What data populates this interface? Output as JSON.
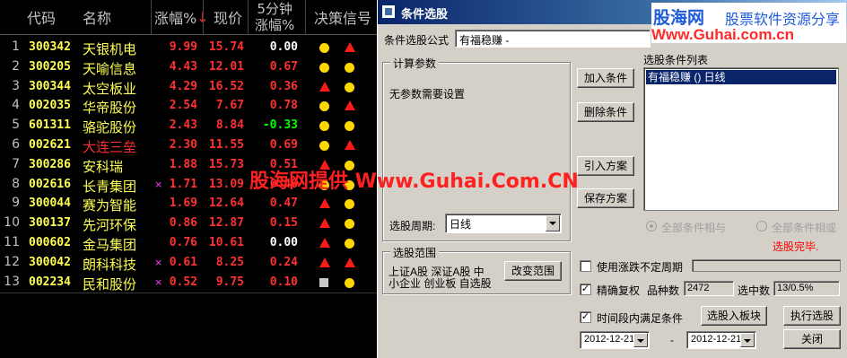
{
  "table": {
    "headers": {
      "code": "代码",
      "name": "名称",
      "pct": "涨幅%",
      "pct_arrow": "↓",
      "price": "现价",
      "five_min_top": "5分钟",
      "five_min_bottom": "涨幅%",
      "signal": "决策信号"
    },
    "rows": [
      {
        "idx": "1",
        "code": "300342",
        "name": "天银机电",
        "name_color": "yellow",
        "mark": "",
        "pct": "9.99",
        "price": "15.74",
        "m5": "0.00",
        "m5_color": "#ffffff",
        "s1": "dot",
        "s2": "tri"
      },
      {
        "idx": "2",
        "code": "300205",
        "name": "天喻信息",
        "name_color": "yellow",
        "mark": "",
        "pct": "4.43",
        "price": "12.01",
        "m5": "0.67",
        "m5_color": "#ff3030",
        "s1": "dot",
        "s2": "dot"
      },
      {
        "idx": "3",
        "code": "300344",
        "name": "太空板业",
        "name_color": "yellow",
        "mark": "",
        "pct": "4.29",
        "price": "16.52",
        "m5": "0.36",
        "m5_color": "#ff3030",
        "s1": "tri",
        "s2": "dot"
      },
      {
        "idx": "4",
        "code": "002035",
        "name": "华帝股份",
        "name_color": "yellow",
        "mark": "",
        "pct": "2.54",
        "price": "7.67",
        "m5": "0.78",
        "m5_color": "#ff3030",
        "s1": "dot",
        "s2": "tri"
      },
      {
        "idx": "5",
        "code": "601311",
        "name": "骆驼股份",
        "name_color": "yellow",
        "mark": "",
        "pct": "2.43",
        "price": "8.84",
        "m5": "-0.33",
        "m5_color": "#00ff00",
        "s1": "dot",
        "s2": "dot"
      },
      {
        "idx": "6",
        "code": "002621",
        "name": "大连三垒",
        "name_color": "red",
        "mark": "",
        "pct": "2.30",
        "price": "11.55",
        "m5": "0.69",
        "m5_color": "#ff3030",
        "s1": "dot",
        "s2": "tri"
      },
      {
        "idx": "7",
        "code": "300286",
        "name": "安科瑞",
        "name_color": "yellow",
        "mark": "",
        "pct": "1.88",
        "price": "15.73",
        "m5": "0.51",
        "m5_color": "#ff3030",
        "s1": "tri",
        "s2": "dot"
      },
      {
        "idx": "8",
        "code": "002616",
        "name": "长青集团",
        "name_color": "yellow",
        "mark": "×",
        "pct": "1.71",
        "price": "13.09",
        "m5": "0.46",
        "m5_color": "#ff3030",
        "s1": "dot",
        "s2": "dot"
      },
      {
        "idx": "9",
        "code": "300044",
        "name": "赛为智能",
        "name_color": "yellow",
        "mark": "",
        "pct": "1.69",
        "price": "12.64",
        "m5": "0.47",
        "m5_color": "#ff3030",
        "s1": "tri",
        "s2": "dot"
      },
      {
        "idx": "10",
        "code": "300137",
        "name": "先河环保",
        "name_color": "yellow",
        "mark": "",
        "pct": "0.86",
        "price": "12.87",
        "m5": "0.15",
        "m5_color": "#ff3030",
        "s1": "tri",
        "s2": "dot"
      },
      {
        "idx": "11",
        "code": "000602",
        "name": "金马集团",
        "name_color": "yellow",
        "mark": "",
        "pct": "0.76",
        "price": "10.61",
        "m5": "0.00",
        "m5_color": "#ffffff",
        "s1": "tri",
        "s2": "dot"
      },
      {
        "idx": "12",
        "code": "300042",
        "name": "朗科科技",
        "name_color": "yellow",
        "mark": "×",
        "pct": "0.61",
        "price": "8.25",
        "m5": "0.24",
        "m5_color": "#ff3030",
        "s1": "tri",
        "s2": "tri"
      },
      {
        "idx": "13",
        "code": "002234",
        "name": "民和股份",
        "name_color": "yellow",
        "mark": "×",
        "pct": "0.52",
        "price": "9.75",
        "m5": "0.10",
        "m5_color": "#ff3030",
        "s1": "sq",
        "s2": "dot"
      }
    ]
  },
  "center_watermark": "股海网提供 Www.Guhai.Com.CN",
  "dialog": {
    "title": "条件选股",
    "logo_brand": "股海网",
    "logo_slogan": "股票软件资源分享",
    "logo_url": "Www.Guhai.com.cn",
    "formula_label": "条件选股公式",
    "formula_value": "有福稳赚 -",
    "params_group": "计算参数",
    "params_text": "无参数需要设置",
    "period_label": "选股周期:",
    "period_value": "日线",
    "range_group": "选股范围",
    "range_line1": "上证A股 深证A股 中",
    "range_line2": "小企业 创业板 自选股",
    "change_range_btn": "改变范围",
    "add_cond_btn": "加入条件",
    "del_cond_btn": "删除条件",
    "import_btn": "引入方案",
    "save_btn": "保存方案",
    "cond_list_label": "选股条件列表",
    "cond_list_item": "有福稳赚  () 日线",
    "radio_and": "全部条件相与",
    "radio_or": "全部条件相或",
    "status": "选股完毕.",
    "use_period_label": "使用涨跌不定周期",
    "exact_restore_label": "精确复权",
    "count_label": "品种数",
    "count_value": "2472",
    "selected_label": "选中数",
    "selected_value": "13/0.5%",
    "time_range_label": "时间段内满足条件",
    "date_from": "2012-12-21",
    "date_sep": "-",
    "date_to": "2012-12-21",
    "to_board_btn": "选股入板块",
    "run_btn": "执行选股",
    "close_btn": "关闭",
    "check_mark": "✓"
  }
}
